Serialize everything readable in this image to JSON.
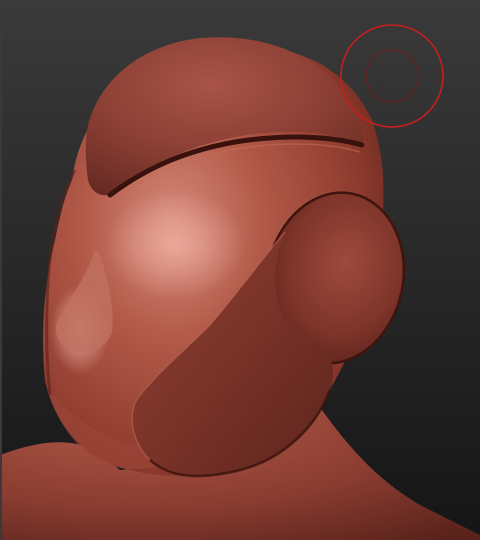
{
  "app": {
    "kind": "3d-sculpting-viewport"
  },
  "viewport": {
    "background_top": "#3c3c3c",
    "background_bottom": "#141414",
    "mesh_color": "#a8493a",
    "mesh_highlight": "#d9887a",
    "mesh_shadow": "#4a1a14",
    "cursor_color": "#cc1f1f"
  },
  "icons": {
    "brush_cursor": "brush-cursor-icon"
  }
}
